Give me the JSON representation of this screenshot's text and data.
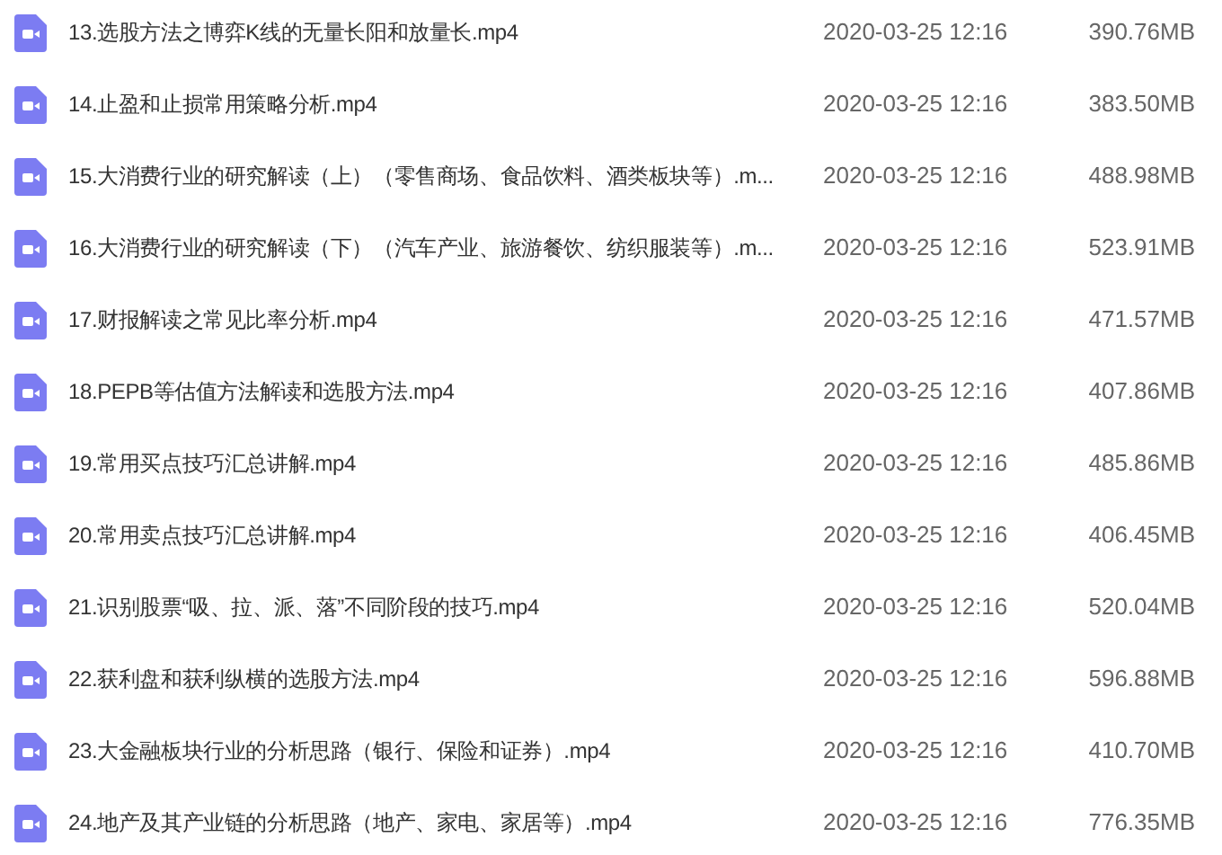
{
  "files": [
    {
      "name": "13.选股方法之博弈K线的无量长阳和放量长.mp4",
      "modified": "2020-03-25 12:16",
      "size": "390.76MB"
    },
    {
      "name": "14.止盈和止损常用策略分析.mp4",
      "modified": "2020-03-25 12:16",
      "size": "383.50MB"
    },
    {
      "name": "15.大消费行业的研究解读（上）（零售商场、食品饮料、酒类板块等）.m...",
      "modified": "2020-03-25 12:16",
      "size": "488.98MB"
    },
    {
      "name": "16.大消费行业的研究解读（下）（汽车产业、旅游餐饮、纺织服装等）.m...",
      "modified": "2020-03-25 12:16",
      "size": "523.91MB"
    },
    {
      "name": "17.财报解读之常见比率分析.mp4",
      "modified": "2020-03-25 12:16",
      "size": "471.57MB"
    },
    {
      "name": "18.PEPB等估值方法解读和选股方法.mp4",
      "modified": "2020-03-25 12:16",
      "size": "407.86MB"
    },
    {
      "name": "19.常用买点技巧汇总讲解.mp4",
      "modified": "2020-03-25 12:16",
      "size": "485.86MB"
    },
    {
      "name": "20.常用卖点技巧汇总讲解.mp4",
      "modified": "2020-03-25 12:16",
      "size": "406.45MB"
    },
    {
      "name": "21.识别股票“吸、拉、派、落”不同阶段的技巧.mp4",
      "modified": "2020-03-25 12:16",
      "size": "520.04MB"
    },
    {
      "name": "22.获利盘和获利纵横的选股方法.mp4",
      "modified": "2020-03-25 12:16",
      "size": "596.88MB"
    },
    {
      "name": "23.大金融板块行业的分析思路（银行、保险和证券）.mp4",
      "modified": "2020-03-25 12:16",
      "size": "410.70MB"
    },
    {
      "name": "24.地产及其产业链的分析思路（地产、家电、家居等）.mp4",
      "modified": "2020-03-25 12:16",
      "size": "776.35MB"
    }
  ]
}
